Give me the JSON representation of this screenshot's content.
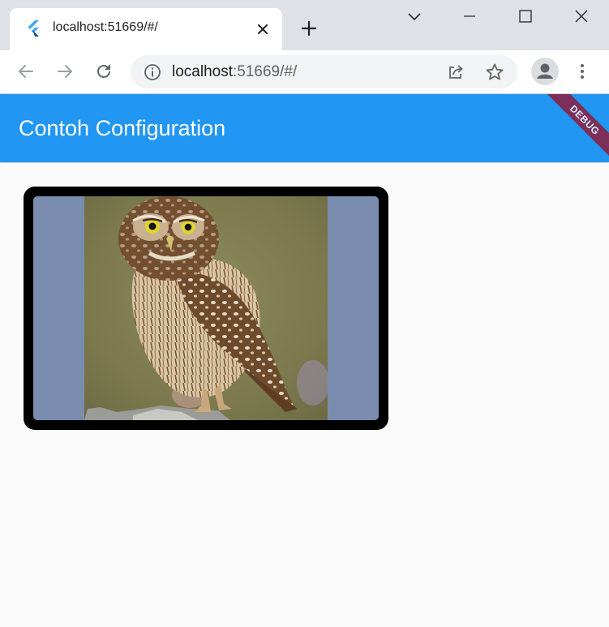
{
  "browser": {
    "tab": {
      "title": "localhost:51669/#/"
    },
    "address_bar": {
      "host": "localhost",
      "path": ":51669/#/"
    },
    "icons": {
      "tab_favicon": "flutter-logo-icon",
      "tab_close": "close-icon",
      "new_tab": "plus-icon",
      "tab_search": "chevron-down-icon",
      "minimize": "minimize-icon",
      "maximize": "maximize-icon",
      "close_window": "close-window-icon",
      "back": "arrow-left-icon",
      "forward": "arrow-right-icon",
      "reload": "reload-icon",
      "site_info": "info-icon",
      "share": "share-icon",
      "bookmark": "star-icon",
      "profile": "avatar-icon",
      "menu": "more-vert-icon"
    }
  },
  "app": {
    "title": "Contoh Configuration",
    "debug_banner": "DEBUG",
    "colors": {
      "app_bar": "#2196f3",
      "background": "#fafafa",
      "card_border": "#000000",
      "image_background": "#7a8daf",
      "debug_banner": "#8b1e3f"
    },
    "image": {
      "subject": "owl-photo"
    }
  }
}
